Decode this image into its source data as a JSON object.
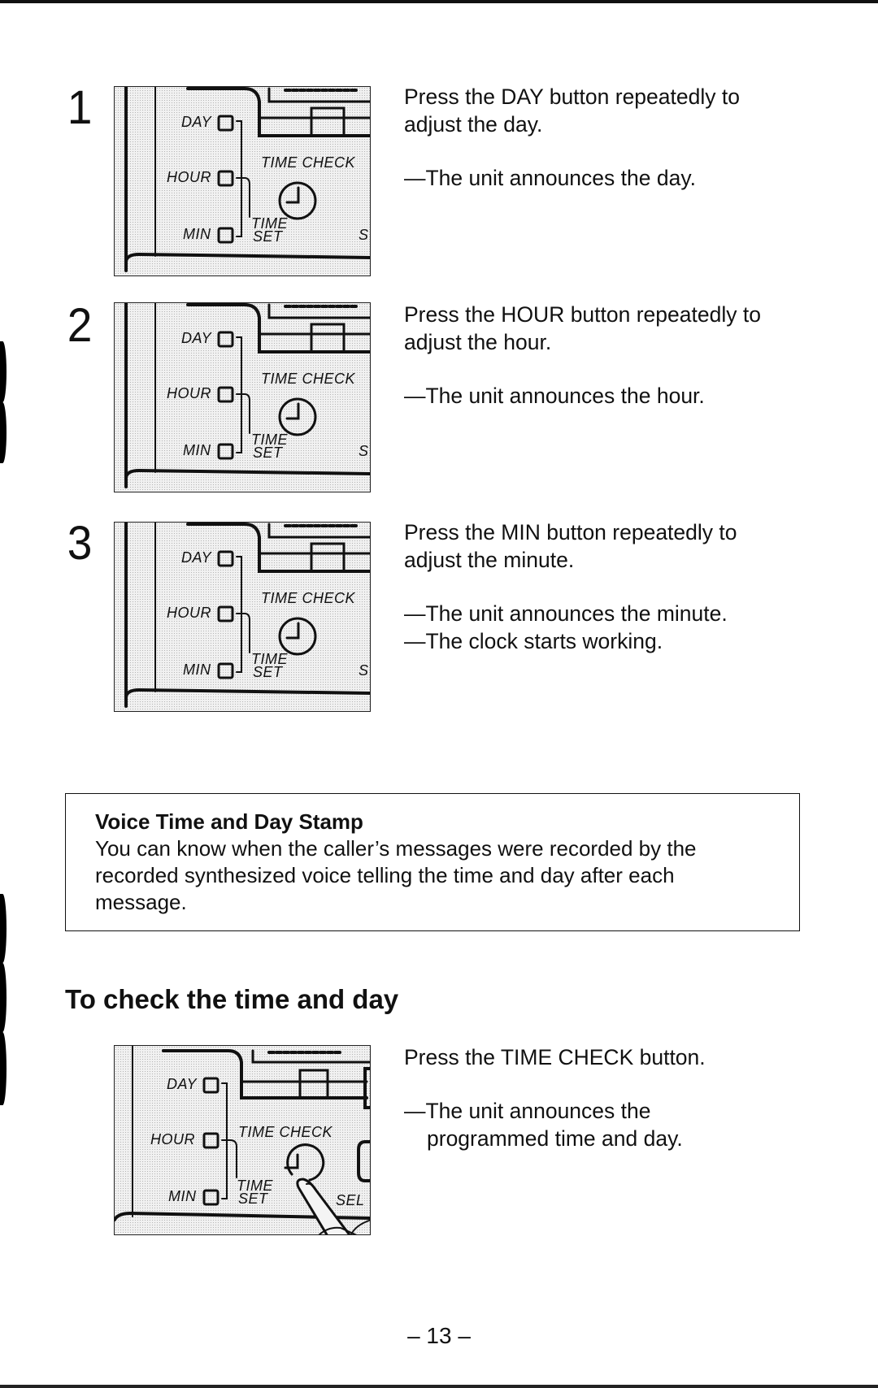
{
  "steps": [
    {
      "number": "1",
      "instruction": "Press the DAY button repeatedly to adjust the day.",
      "results": [
        "—The unit announces the day."
      ],
      "panel": {
        "labels": {
          "day": "DAY",
          "hour": "HOUR",
          "min": "MIN",
          "time_check": "TIME CHECK",
          "time": "TIME",
          "set": "SET",
          "edge": "S"
        }
      }
    },
    {
      "number": "2",
      "instruction": "Press the HOUR button repeatedly to adjust the hour.",
      "results": [
        "—The unit announces the hour."
      ],
      "panel": {
        "labels": {
          "day": "DAY",
          "hour": "HOUR",
          "min": "MIN",
          "time_check": "TIME CHECK",
          "time": "TIME",
          "set": "SET",
          "edge": "S"
        }
      }
    },
    {
      "number": "3",
      "instruction": "Press the MIN button repeatedly to adjust the minute.",
      "results": [
        "—The unit announces the minute.",
        "—The clock starts working."
      ],
      "panel": {
        "labels": {
          "day": "DAY",
          "hour": "HOUR",
          "min": "MIN",
          "time_check": "TIME CHECK",
          "time": "TIME",
          "set": "SET",
          "edge": "S"
        }
      }
    }
  ],
  "note": {
    "title": "Voice Time and Day Stamp",
    "body": "You can know when the caller’s messages were recorded by the recorded synthesized voice telling the time and day after each message."
  },
  "check_section": {
    "heading": "To check the time and day",
    "instruction": "Press the TIME CHECK button.",
    "result_line1": "—The unit announces the",
    "result_line2": "programmed time and day.",
    "panel": {
      "labels": {
        "day": "DAY",
        "hour": "HOUR",
        "min": "MIN",
        "time_check": "TIME CHECK",
        "time": "TIME",
        "set": "SET",
        "edge": "SEL"
      }
    }
  },
  "page_number": "– 13 –"
}
